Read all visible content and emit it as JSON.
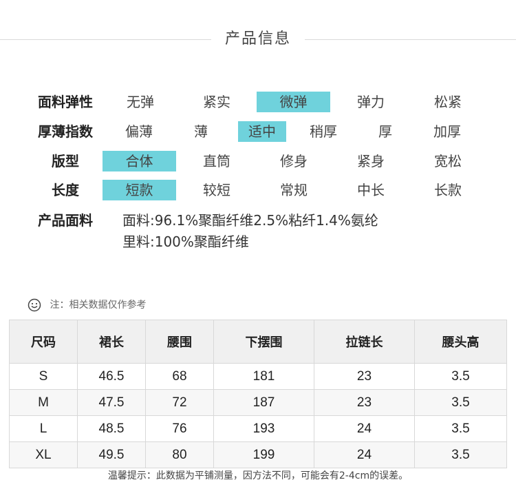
{
  "title": "产品信息",
  "attributes": [
    {
      "label": "面料弹性",
      "options": [
        "无弹",
        "紧实",
        "微弹",
        "弹力",
        "松紧"
      ],
      "selected": 2
    },
    {
      "label": "厚薄指数",
      "options": [
        "偏薄",
        "薄",
        "适中",
        "稍厚",
        "厚",
        "加厚"
      ],
      "selected": 2
    },
    {
      "label": "版型",
      "options": [
        "合体",
        "直筒",
        "修身",
        "紧身",
        "宽松"
      ],
      "selected": 0
    },
    {
      "label": "长度",
      "options": [
        "短款",
        "较短",
        "常规",
        "中长",
        "长款"
      ],
      "selected": 0
    }
  ],
  "fabric": {
    "label": "产品面料",
    "line1": "面料:96.1%聚酯纤维2.5%粘纤1.4%氨纶",
    "line2": "里料:100%聚酯纤维"
  },
  "note": {
    "icon": "smile-icon",
    "text": "注：相关数据仅作参考"
  },
  "size_table": {
    "headers": [
      "尺码",
      "裙长",
      "腰围",
      "下摆围",
      "拉链长",
      "腰头高"
    ],
    "rows": [
      [
        "S",
        "46.5",
        "68",
        "181",
        "23",
        "3.5"
      ],
      [
        "M",
        "47.5",
        "72",
        "187",
        "23",
        "3.5"
      ],
      [
        "L",
        "48.5",
        "76",
        "193",
        "24",
        "3.5"
      ],
      [
        "XL",
        "49.5",
        "80",
        "199",
        "24",
        "3.5"
      ]
    ]
  },
  "footer": "温馨提示：此数据为平铺测量，因方法不同，可能会有2-4cm的误差。",
  "colors": {
    "highlight": "#6fd2dc",
    "header_bg": "#f0f0f0",
    "border": "#d8d8d8"
  }
}
